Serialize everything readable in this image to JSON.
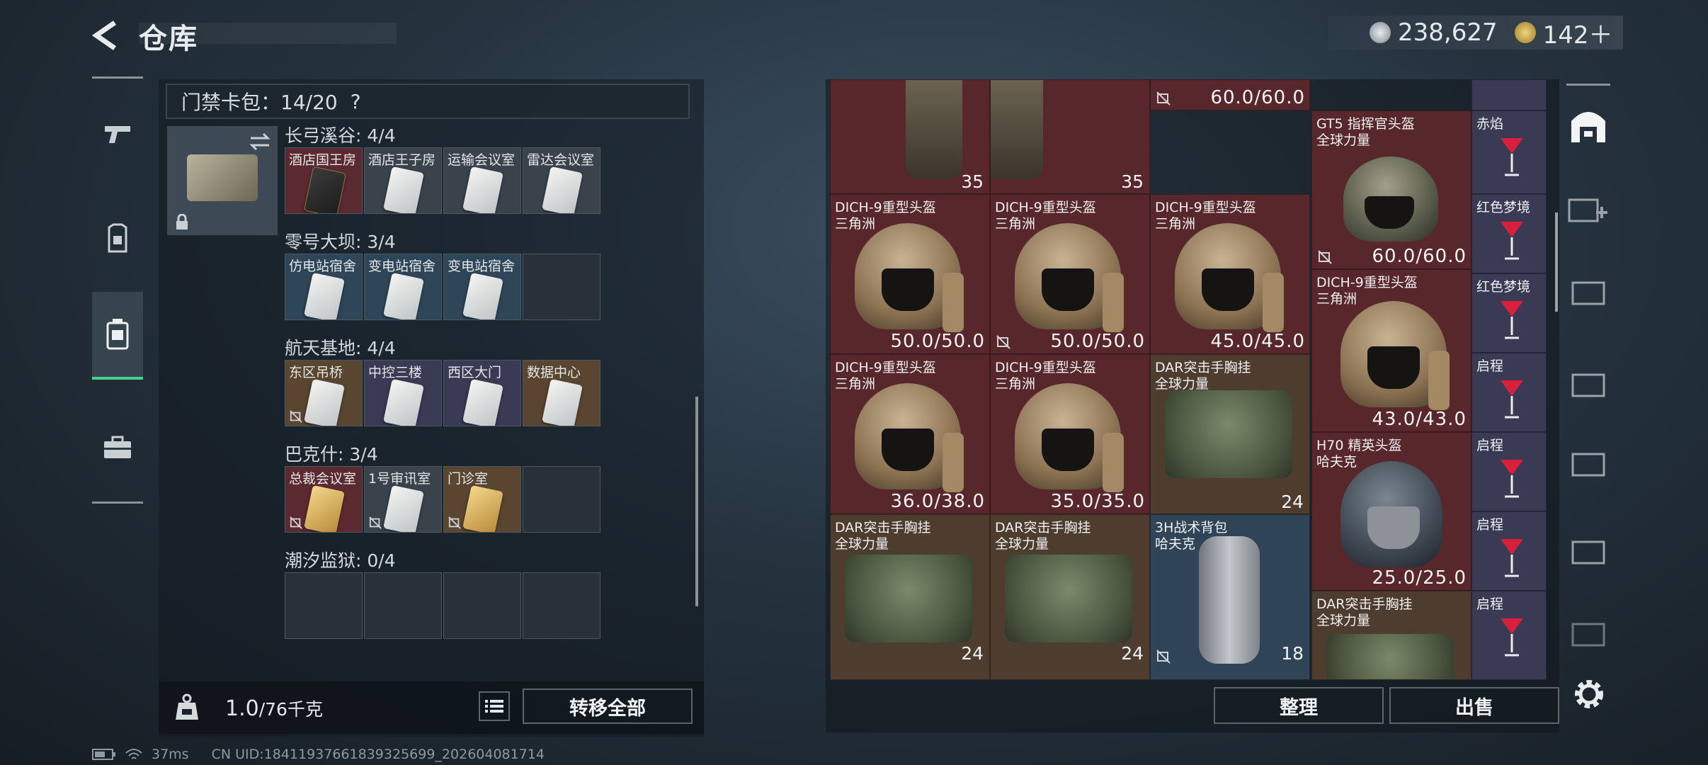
{
  "header": {
    "title": "仓库",
    "currency1": "238,627",
    "currency2": "142＋"
  },
  "cardpack": {
    "label": "门禁卡包：14/20",
    "help": "?"
  },
  "sections": [
    {
      "title": "长弓溪谷: 4/4",
      "slots": [
        {
          "label": "酒店国王房",
          "color": "c-red",
          "card": "dark"
        },
        {
          "label": "酒店王子房",
          "color": "c-gray",
          "card": "plain"
        },
        {
          "label": "运输会议室",
          "color": "c-gray",
          "card": "plain"
        },
        {
          "label": "雷达会议室",
          "color": "c-gray",
          "card": "plain"
        }
      ]
    },
    {
      "title": "零号大坝: 3/4",
      "slots": [
        {
          "label": "仿电站宿舍",
          "color": "c-blue",
          "card": "plain"
        },
        {
          "label": "变电站宿舍",
          "color": "c-blue",
          "card": "plain"
        },
        {
          "label": "变电站宿舍",
          "color": "c-blue",
          "card": "plain"
        },
        {
          "label": "",
          "color": "c-empty",
          "card": "none"
        }
      ]
    },
    {
      "title": "航天基地: 4/4",
      "slots": [
        {
          "label": "东区吊桥",
          "color": "c-gold",
          "card": "plain",
          "nosell": true
        },
        {
          "label": "中控三楼",
          "color": "c-purple",
          "card": "plain"
        },
        {
          "label": "西区大门",
          "color": "c-purple",
          "card": "plain"
        },
        {
          "label": "数据中心",
          "color": "c-gold",
          "card": "plain"
        }
      ]
    },
    {
      "title": "巴克什: 3/4",
      "slots": [
        {
          "label": "总裁会议室",
          "color": "c-red",
          "card": "gold",
          "nosell": true
        },
        {
          "label": "1号审讯室",
          "color": "c-gray",
          "card": "plain",
          "nosell": true
        },
        {
          "label": "门诊室",
          "color": "c-gold",
          "card": "gold",
          "nosell": true
        },
        {
          "label": "",
          "color": "c-empty",
          "card": "none"
        }
      ]
    },
    {
      "title": "潮汐监狱: 0/4",
      "slots": [
        {
          "label": "",
          "color": "c-empty",
          "card": "none"
        },
        {
          "label": "",
          "color": "c-empty",
          "card": "none"
        },
        {
          "label": "",
          "color": "c-empty",
          "card": "none"
        },
        {
          "label": "",
          "color": "c-empty",
          "card": "none"
        }
      ]
    }
  ],
  "weight": {
    "value": "1.0",
    "max": "/76千克"
  },
  "buttons": {
    "transfer": "转移全部",
    "sort": "整理",
    "sell": "出售"
  },
  "items": {
    "top_count1": "35",
    "top_count2": "35",
    "top_val": "60.0/60.0",
    "gt5_n1": "GT5 指挥官头盔",
    "gt5_n2": "全球力量",
    "gt5_val": "60.0/60.0",
    "dich_n1": "DICH-9重型头盔",
    "dich_n2": "三角洲",
    "v_a": "50.0/50.0",
    "v_b": "50.0/50.0",
    "v_c": "45.0/45.0",
    "v_d": "43.0/43.0",
    "v_e": "36.0/38.0",
    "v_f": "35.0/35.0",
    "dar_n1": "DAR突击手胸挂",
    "dar_n2": "全球力量",
    "dar_cnt": "24",
    "bag_n1": "3H战术背包",
    "bag_n2": "哈夫克",
    "bag_cnt": "18",
    "h70_n1": "H70 精英头盔",
    "h70_n2": "哈夫克",
    "h70_val": "25.0/25.0"
  },
  "drinks": [
    "赤焰",
    "红色梦境",
    "红色梦境",
    "启程",
    "启程",
    "启程",
    "启程"
  ],
  "status": {
    "ping": "37ms",
    "uid": "CN UID:1841193766183932569​9_202604081714"
  }
}
